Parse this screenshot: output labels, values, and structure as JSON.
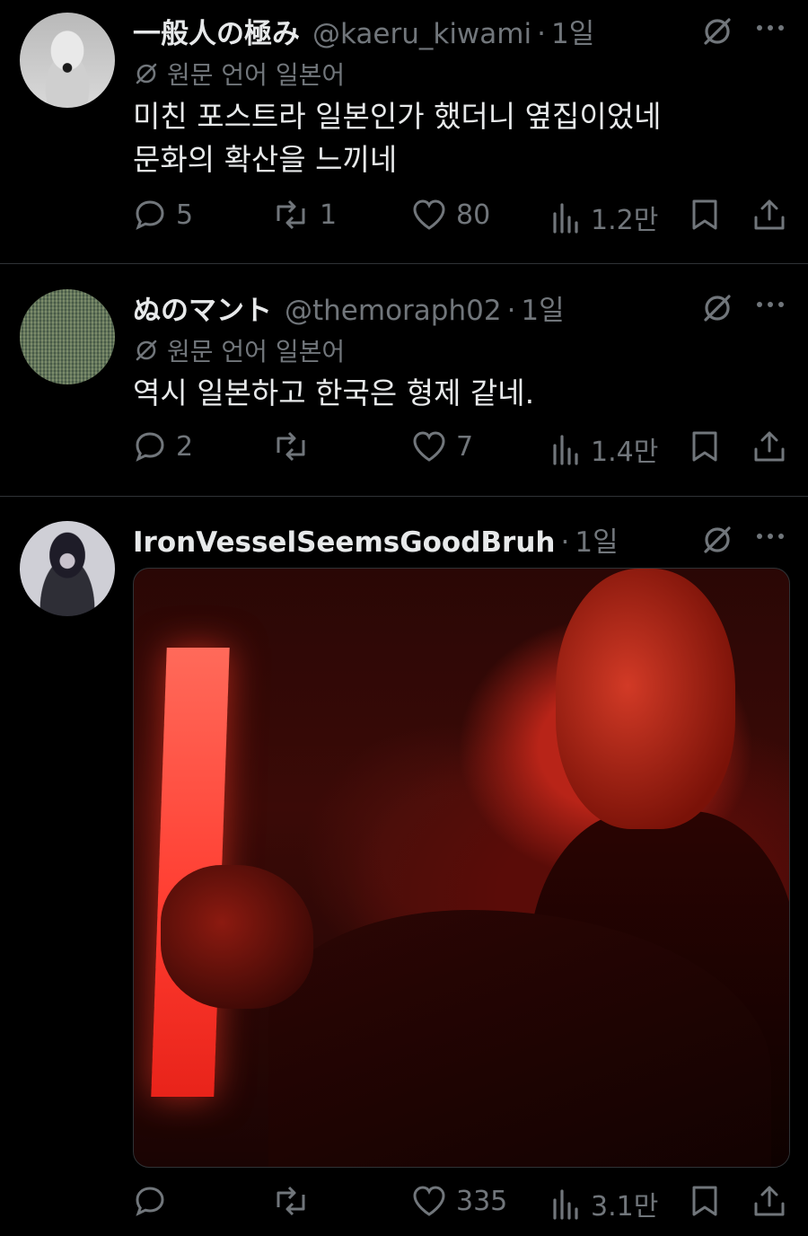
{
  "tweets": [
    {
      "name": "一般人の極み",
      "handle": "@kaeru_kiwami",
      "time": "1일",
      "translated_label": "원문 언어 일본어",
      "text_lines": [
        "미친 포스트라 일본인가 했더니 옆집이었네",
        "문화의 확산을 느끼네"
      ],
      "replies": "5",
      "reposts": "1",
      "likes": "80",
      "views": "1.2만"
    },
    {
      "name": "ぬのマント",
      "handle": "@themoraph02",
      "time": "1일",
      "translated_label": "원문 언어 일본어",
      "text_lines": [
        "역시 일본하고 한국은 형제 같네."
      ],
      "replies": "2",
      "reposts": "",
      "likes": "7",
      "views": "1.4만"
    },
    {
      "name": "IronVesselSeemsGoodBruh",
      "handle": "",
      "time": "1일",
      "replies": "",
      "reposts": "",
      "likes": "335",
      "views": "3.1만"
    }
  ],
  "dot": "·",
  "icons": {
    "reply": "reply-icon",
    "repost": "repost-icon",
    "like": "heart-icon",
    "views": "views-icon",
    "bookmark": "bookmark-icon",
    "share": "share-icon",
    "grok": "grok-icon",
    "more": "more-icon"
  },
  "colors": {
    "background": "#000000",
    "text": "#e7e9ea",
    "secondary": "#71767b",
    "divider": "#2f3336"
  }
}
